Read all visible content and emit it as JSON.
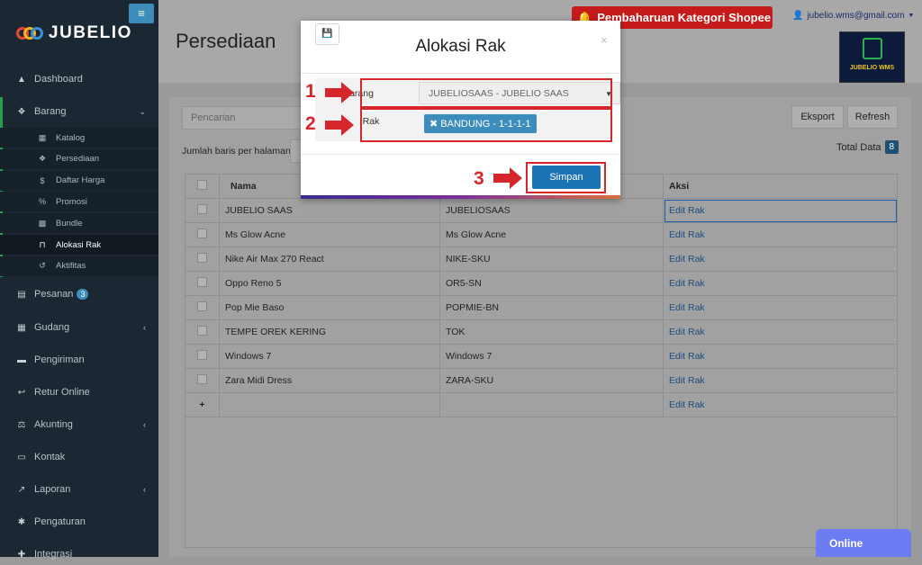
{
  "app": {
    "name": "JUBELIO",
    "page_title": "Persediaan"
  },
  "header": {
    "notification": "Pembaharuan Kategori Shopee",
    "user_email": "jubelio.wms@gmail.com",
    "brand_badge": "JUBELIO WMS"
  },
  "sidebar": {
    "items": [
      {
        "label": "Dashboard",
        "icon": "chart-area-icon"
      },
      {
        "label": "Barang",
        "icon": "cubes-icon",
        "expanded": true
      },
      {
        "label": "Pesanan",
        "icon": "shopping-basket-icon",
        "badge": "3"
      },
      {
        "label": "Gudang",
        "icon": "building-icon"
      },
      {
        "label": "Pengiriman",
        "icon": "truck-icon"
      },
      {
        "label": "Retur Online",
        "icon": "reply-icon"
      },
      {
        "label": "Akunting",
        "icon": "balance-scale-icon"
      },
      {
        "label": "Kontak",
        "icon": "address-card-icon"
      },
      {
        "label": "Laporan",
        "icon": "line-chart-icon"
      },
      {
        "label": "Pengaturan",
        "icon": "cogs-icon"
      },
      {
        "label": "Integrasi",
        "icon": "puzzle-icon"
      }
    ],
    "barang_subitems": [
      {
        "label": "Katalog",
        "icon": "th-icon"
      },
      {
        "label": "Persediaan",
        "icon": "cubes-icon"
      },
      {
        "label": "Daftar Harga",
        "icon": "dollar-icon"
      },
      {
        "label": "Promosi",
        "icon": "percent-icon"
      },
      {
        "label": "Bundle",
        "icon": "th-large-icon"
      },
      {
        "label": "Alokasi Rak",
        "icon": "bookmark-icon",
        "active": true
      },
      {
        "label": "Aktifitas",
        "icon": "history-icon"
      }
    ]
  },
  "toolbar": {
    "search_placeholder": "Pencarian",
    "export_label": "Eksport",
    "refresh_label": "Refresh",
    "rows_per_page_label": "Jumlah baris per halaman",
    "total_label": "Total Data",
    "total_count": "8"
  },
  "table": {
    "columns": [
      "Nama",
      "",
      "Aksi"
    ],
    "rows": [
      {
        "nama": "JUBELIO SAAS",
        "sku": "JUBELIOSAAS",
        "aksi": "Edit Rak"
      },
      {
        "nama": "Ms Glow Acne",
        "sku": "Ms Glow Acne",
        "aksi": "Edit Rak"
      },
      {
        "nama": "Nike Air Max 270 React",
        "sku": "NIKE-SKU",
        "aksi": "Edit Rak"
      },
      {
        "nama": "Oppo Reno 5",
        "sku": "OR5-SN",
        "aksi": "Edit Rak"
      },
      {
        "nama": "Pop Mie Baso",
        "sku": "POPMIE-BN",
        "aksi": "Edit Rak"
      },
      {
        "nama": "TEMPE OREK KERING",
        "sku": "TOK",
        "aksi": "Edit Rak"
      },
      {
        "nama": "Windows 7",
        "sku": "Windows 7",
        "aksi": "Edit Rak"
      },
      {
        "nama": "Zara Midi Dress",
        "sku": "ZARA-SKU",
        "aksi": "Edit Rak"
      }
    ],
    "add_row": {
      "icon": "+",
      "aksi": "Edit Rak"
    }
  },
  "modal": {
    "title": "Alokasi Rak",
    "close": "×",
    "barang_label": "Barang",
    "barang_value": "JUBELIOSAAS - JUBELIO SAAS",
    "rak_label": "Rak",
    "rak_tag": "BANDUNG - 1-1-1-1",
    "save_label": "Simpan"
  },
  "annotations": {
    "step1": "1",
    "step2": "2",
    "step3": "3"
  },
  "online_label": "Online",
  "colors": {
    "sidebar": "#1b2833",
    "accent": "#3c8dbc",
    "notification": "#c61b1b",
    "annotation": "#d7262b",
    "primary_button": "#1b74b5"
  }
}
